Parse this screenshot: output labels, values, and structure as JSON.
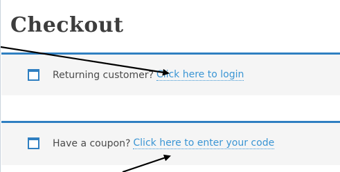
{
  "page": {
    "title": "Checkout"
  },
  "notices": {
    "login": {
      "text": "Returning customer?",
      "link": "Click here to login"
    },
    "coupon": {
      "text": "Have a coupon?",
      "link": "Click here to enter your code"
    }
  },
  "icons": {
    "notice": "window-icon",
    "annotation": "arrow"
  },
  "colors": {
    "accent": "#2f7fc1",
    "link": "#3a95d4",
    "notice_bg": "#f5f5f5",
    "title": "#3d3d3d",
    "annotation_arrow": "#000000"
  }
}
